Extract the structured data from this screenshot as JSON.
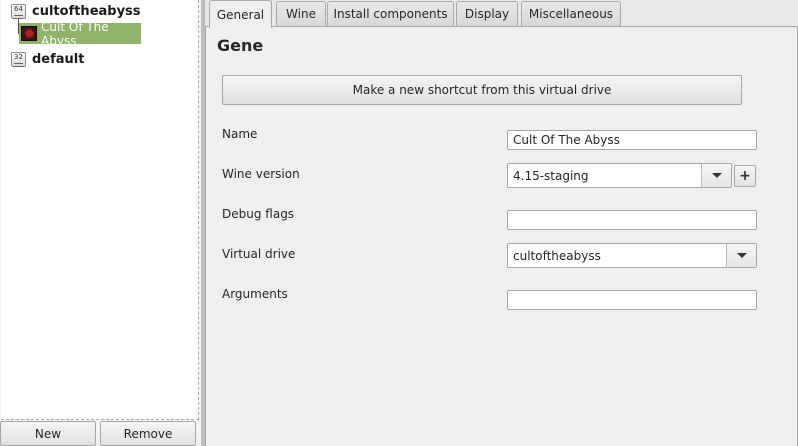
{
  "tree": {
    "prefixes": [
      {
        "bits": "64",
        "name": "cultoftheabyss"
      },
      {
        "bits": "32",
        "name": "default"
      }
    ],
    "selected_shortcut": "Cult Of The Abyss",
    "shortcut_icon": "game-skull-icon"
  },
  "left_buttons": {
    "new_label": "New",
    "remove_label": "Remove"
  },
  "tabs": [
    {
      "label": "General",
      "active": true
    },
    {
      "label": "Wine"
    },
    {
      "label": "Install components"
    },
    {
      "label": "Display"
    },
    {
      "label": "Miscellaneous"
    }
  ],
  "general": {
    "heading": "Gene",
    "make_shortcut_label": "Make a new shortcut from this virtual drive",
    "fields": {
      "name_label": "Name",
      "name_value": "Cult Of The Abyss",
      "wine_version_label": "Wine version",
      "wine_version_value": "4.15-staging",
      "add_wine_label": "+",
      "debug_flags_label": "Debug flags",
      "debug_flags_value": "",
      "virtual_drive_label": "Virtual drive",
      "virtual_drive_value": "cultoftheabyss",
      "arguments_label": "Arguments",
      "arguments_value": ""
    }
  }
}
